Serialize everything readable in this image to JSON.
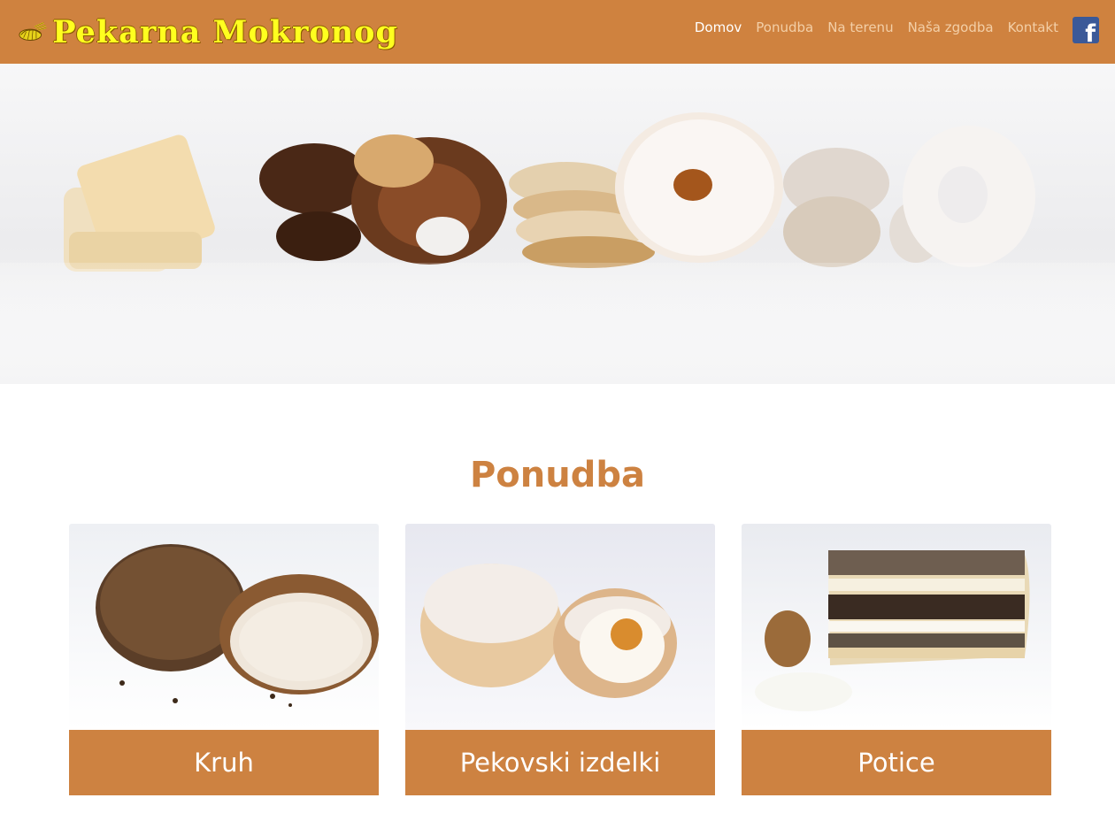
{
  "brand": {
    "name": "Pekarna Mokronog"
  },
  "nav": {
    "items": [
      {
        "label": "Domov",
        "active": true
      },
      {
        "label": "Ponudba",
        "active": false
      },
      {
        "label": "Na terenu",
        "active": false
      },
      {
        "label": "Naša zgodba",
        "active": false
      },
      {
        "label": "Kontakt",
        "active": false
      }
    ],
    "facebook_icon": "facebook-icon"
  },
  "colors": {
    "brand": "#cf823f",
    "logo_text": "#ffff1f",
    "heading": "#cd8241",
    "facebook": "#3b5998"
  },
  "offer": {
    "title": "Ponudba",
    "cards": [
      {
        "label": "Kruh"
      },
      {
        "label": "Pekovski izdelki"
      },
      {
        "label": "Potice"
      }
    ]
  }
}
